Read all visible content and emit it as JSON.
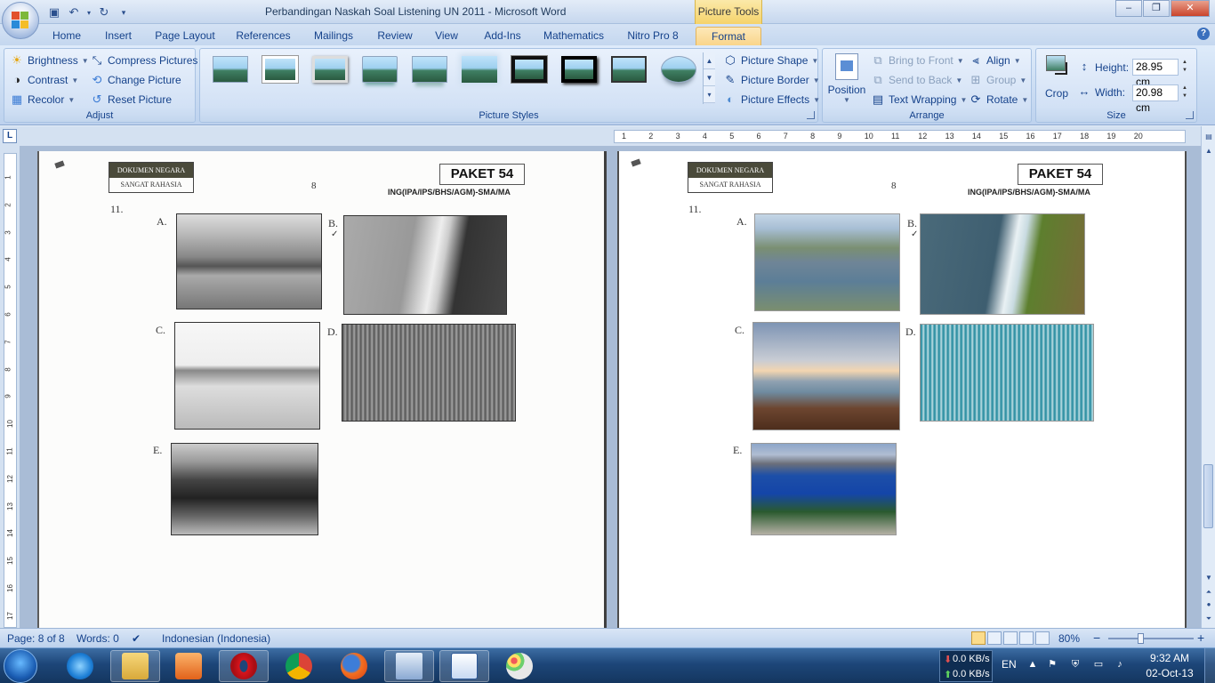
{
  "window": {
    "title": "Perbandingan Naskah Soal Listening UN 2011  -  Microsoft Word",
    "context_tab_group": "Picture Tools",
    "controls": {
      "minimize": "–",
      "maximize": "❐",
      "close": "✕"
    }
  },
  "tabs": [
    {
      "label": "Home"
    },
    {
      "label": "Insert"
    },
    {
      "label": "Page Layout"
    },
    {
      "label": "References"
    },
    {
      "label": "Mailings"
    },
    {
      "label": "Review"
    },
    {
      "label": "View"
    },
    {
      "label": "Add-Ins"
    },
    {
      "label": "Mathematics"
    },
    {
      "label": "Nitro Pro 8"
    },
    {
      "label": "Format",
      "active": true
    }
  ],
  "ribbon": {
    "adjust": {
      "label": "Adjust",
      "brightness": "Brightness",
      "contrast": "Contrast",
      "recolor": "Recolor",
      "compress": "Compress Pictures",
      "change": "Change Picture",
      "reset": "Reset Picture"
    },
    "styles": {
      "label": "Picture Styles",
      "shape": "Picture Shape",
      "border": "Picture Border",
      "effects": "Picture Effects"
    },
    "arrange": {
      "label": "Arrange",
      "position": "Position",
      "bring_front": "Bring to Front",
      "send_back": "Send to Back",
      "text_wrapping": "Text Wrapping",
      "align": "Align",
      "group": "Group",
      "rotate": "Rotate"
    },
    "size": {
      "label": "Size",
      "crop": "Crop",
      "height_label": "Height:",
      "height_value": "28.95 cm",
      "width_label": "Width:",
      "width_value": "20.98 cm"
    }
  },
  "tab_selector": "L",
  "ruler_numbers": [
    "1",
    "2",
    "3",
    "4",
    "5",
    "6",
    "7",
    "8",
    "9",
    "10",
    "11",
    "12",
    "13",
    "14",
    "15",
    "16",
    "17",
    "18",
    "19",
    "20"
  ],
  "v_ruler_numbers": [
    "1",
    "2",
    "3",
    "4",
    "5",
    "6",
    "7",
    "8",
    "9",
    "10",
    "11",
    "12",
    "13",
    "14",
    "15",
    "16",
    "17"
  ],
  "doc": {
    "dokumen_negara": "DOKUMEN NEGARA",
    "sangat_rahasia": "SANGAT RAHASIA",
    "page_number": "8",
    "paket": "PAKET 54",
    "subject": "ING(IPA/IPS/BHS/AGM)-SMA/MA",
    "question_number": "11.",
    "options": [
      "A.",
      "B.",
      "C.",
      "D.",
      "E."
    ],
    "check_mark": "✓"
  },
  "status": {
    "page": "Page: 8 of 8",
    "words": "Words: 0",
    "language": "Indonesian (Indonesia)",
    "zoom": "80%",
    "zoom_minus": "−",
    "zoom_plus": "+"
  },
  "taskbar": {
    "net_down": "0.0 KB/s",
    "net_up": "0.0 KB/s",
    "lang": "EN",
    "time": "9:32 AM",
    "date": "02-Oct-13"
  },
  "colors": {
    "ribbon_blue": "#15428b",
    "active_tab": "#f9d58b",
    "taskbar": "#1d4679"
  }
}
